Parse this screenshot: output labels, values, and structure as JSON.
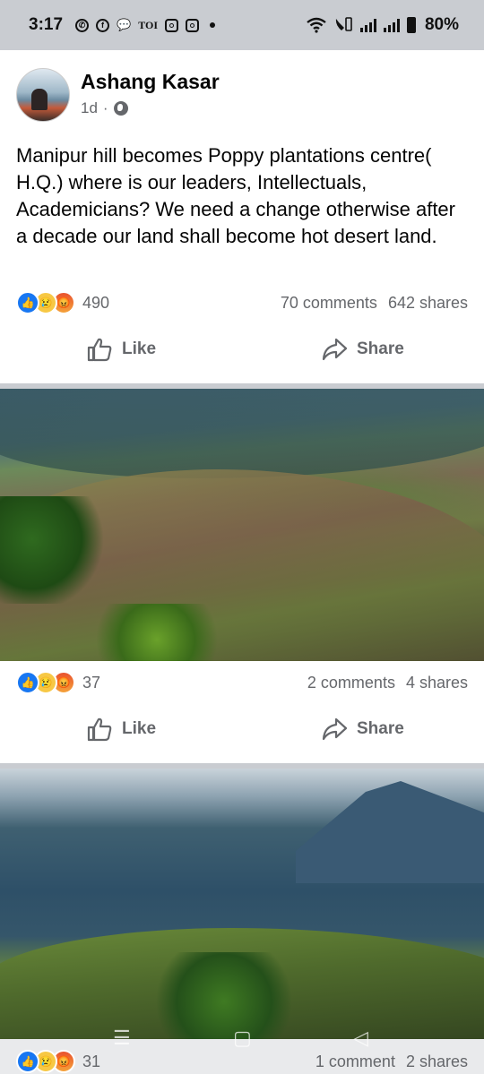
{
  "status": {
    "time": "3:17",
    "toi": "TOI",
    "battery": "80%",
    "icons": [
      "whatsapp-icon",
      "facebook-icon",
      "chat-icon",
      "toi-icon",
      "instagram-icon",
      "instagram-icon",
      "dot-icon",
      "wifi-icon",
      "volte-icon",
      "signal-icon",
      "signal-icon",
      "battery-icon"
    ]
  },
  "post": {
    "author": "Ashang Kasar",
    "time": "1d",
    "separator": "·",
    "text": "Manipur hill becomes Poppy plantations centre( H.Q.) where is our leaders, Intellectuals, Academicians? We need a change otherwise after a decade our land shall become hot desert land.",
    "reactions_count": "490",
    "comments": "70 comments",
    "shares": "642 shares"
  },
  "actions": {
    "like": "Like",
    "share": "Share"
  },
  "photo1": {
    "reactions_count": "37",
    "comments": "2 comments",
    "shares": "4 shares"
  },
  "photo2": {
    "reactions_count": "31",
    "comments": "1 comment",
    "shares": "2 shares"
  },
  "colors": {
    "accent": "#1877f2",
    "muted": "#65676b",
    "separator": "#c9ccd1"
  }
}
